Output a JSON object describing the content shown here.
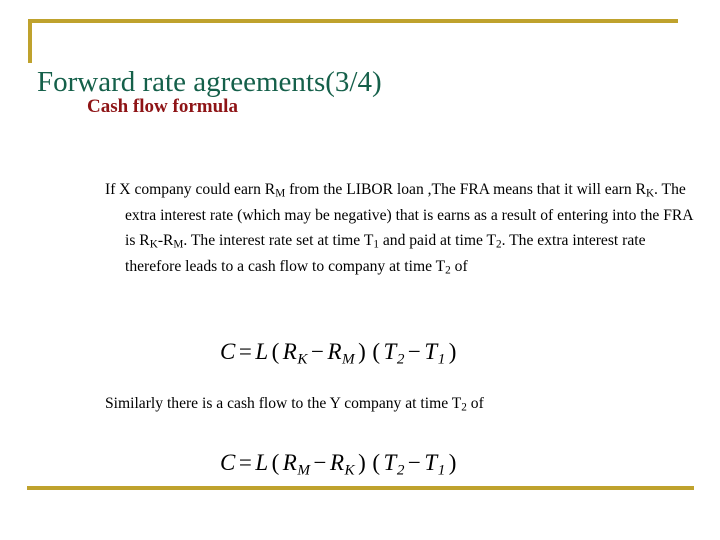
{
  "slide": {
    "title": "Forward rate agreements(3/4)",
    "subtitle": "Cash flow formula",
    "accent_color": "#bfa22d",
    "title_color": "#15604a",
    "subtitle_color": "#8e1416",
    "background_color": "#ffffff"
  },
  "body": {
    "paragraph_1": {
      "segments": [
        "If  X company could earn R",
        "M",
        " from the LIBOR loan ,The FRA means that it will earn R",
        "K",
        ". The extra interest rate (which may be negative) that is earns as a result of entering into the FRA is R",
        "K",
        "-R",
        "M",
        ". The interest rate set at time T",
        "1",
        " and paid at time T",
        "2",
        ". The extra interest rate therefore leads to  a cash flow to company at time T",
        "2",
        " of"
      ],
      "plain_text": "If  X company could earn RM from the LIBOR loan ,The FRA means that it will earn RK. The extra interest rate (which may be negative) that is earns as a result of entering into the FRA is RK-RM. The interest rate set at time T1 and paid at time T2. The extra interest rate therefore leads to  a cash flow to company at time T2 of"
    },
    "paragraph_2": {
      "plain_text": "Similarly there is a cash flow to the  Y  company  at time T2 of",
      "segments": [
        "Similarly there is a cash flow to the  Y  company  at time T",
        "2",
        " of"
      ]
    }
  },
  "formulas": {
    "formula_1": {
      "latex": "C = L(R_K - R_M)(T_2 - T_1)",
      "lhs": "C",
      "equals": "=",
      "scale": "L",
      "rate_first": "R",
      "rate_first_sub": "K",
      "minus": "−",
      "rate_second": "R",
      "rate_second_sub": "M",
      "time_first": "T",
      "time_first_sub": "2",
      "time_second": "T",
      "time_second_sub": "1"
    },
    "formula_2": {
      "latex": "C = L(R_M - R_K)(T_2 - T_1)",
      "lhs": "C",
      "equals": "=",
      "scale": "L",
      "rate_first": "R",
      "rate_first_sub": "M",
      "minus": "−",
      "rate_second": "R",
      "rate_second_sub": "K",
      "time_first": "T",
      "time_first_sub": "2",
      "time_second": "T",
      "time_second_sub": "1"
    }
  }
}
